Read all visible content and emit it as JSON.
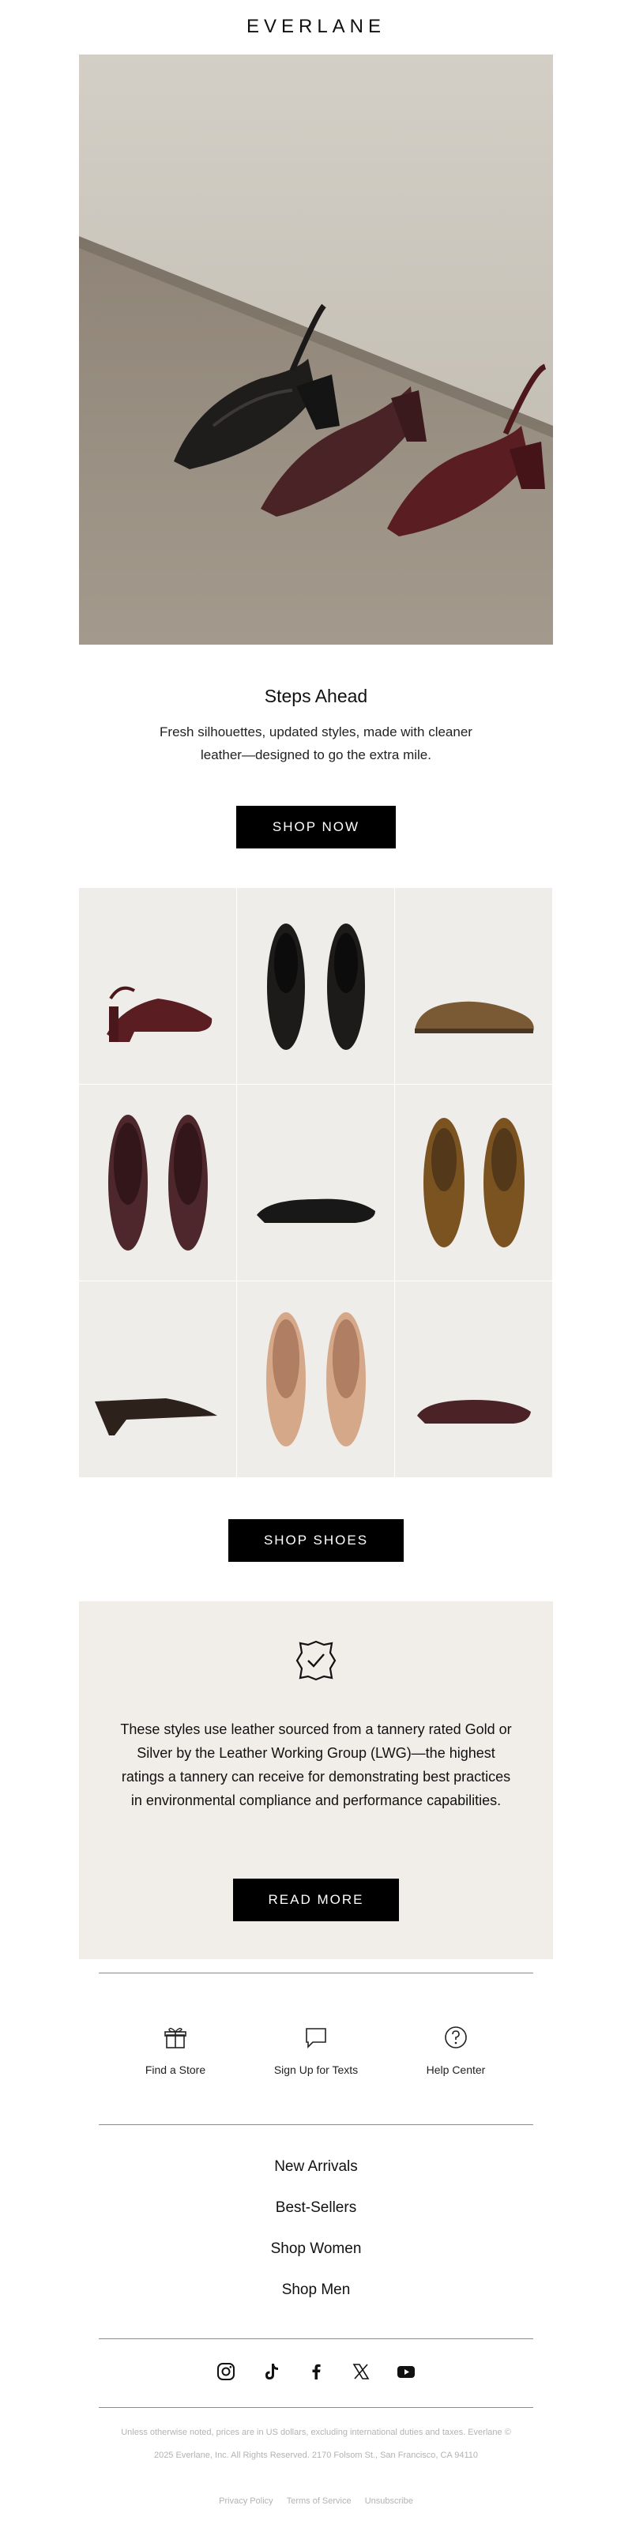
{
  "brand": {
    "logo": "EVERLANE"
  },
  "hero": {
    "image_name": "slingback-heels-on-concrete",
    "headline": "Steps Ahead",
    "subcopy": "Fresh silhouettes, updated styles, made with cleaner leather—designed to go the extra mile.",
    "cta": "SHOP NOW"
  },
  "products": {
    "items": [
      {
        "name": "burgundy-slingback-heel"
      },
      {
        "name": "black-loafer-pair"
      },
      {
        "name": "brown-suede-lace-up"
      },
      {
        "name": "burgundy-ballet-flat-pair"
      },
      {
        "name": "black-ballet-flat"
      },
      {
        "name": "brown-suede-loafer-pair"
      },
      {
        "name": "brown-suede-mule"
      },
      {
        "name": "tan-bow-ballet-flat-pair"
      },
      {
        "name": "burgundy-flat"
      }
    ],
    "cta": "SHOP SHOES"
  },
  "leather": {
    "icon": "leather-check-icon",
    "copy": "These styles use leather sourced from a tannery rated Gold or Silver by the Leather Working Group (LWG)—the highest ratings a tannery can receive for demonstrating best practices in environmental compliance and performance capabilities.",
    "cta": "READ MORE"
  },
  "services": [
    {
      "icon": "gift-icon",
      "label": "Find a Store"
    },
    {
      "icon": "chat-bubble-icon",
      "label": "Sign Up for Texts"
    },
    {
      "icon": "help-circle-icon",
      "label": "Help Center"
    }
  ],
  "nav": [
    "New Arrivals",
    "Best-Sellers",
    "Shop Women",
    "Shop Men"
  ],
  "social": [
    "instagram-icon",
    "tiktok-icon",
    "facebook-icon",
    "x-icon",
    "youtube-icon"
  ],
  "legal": {
    "line1": "Unless otherwise noted, prices are in US dollars, excluding international duties and taxes. Everlane ©",
    "line2": "2025 Everlane, Inc. All Rights Reserved. 2170 Folsom St., San Francisco, CA 94110"
  },
  "footer_links": [
    "Privacy Policy",
    "Terms of Service",
    "Unsubscribe"
  ],
  "colors": {
    "button": "#000000",
    "panel": "#f1eeea",
    "tile": "#efedea",
    "legal": "#b3b3b3"
  }
}
